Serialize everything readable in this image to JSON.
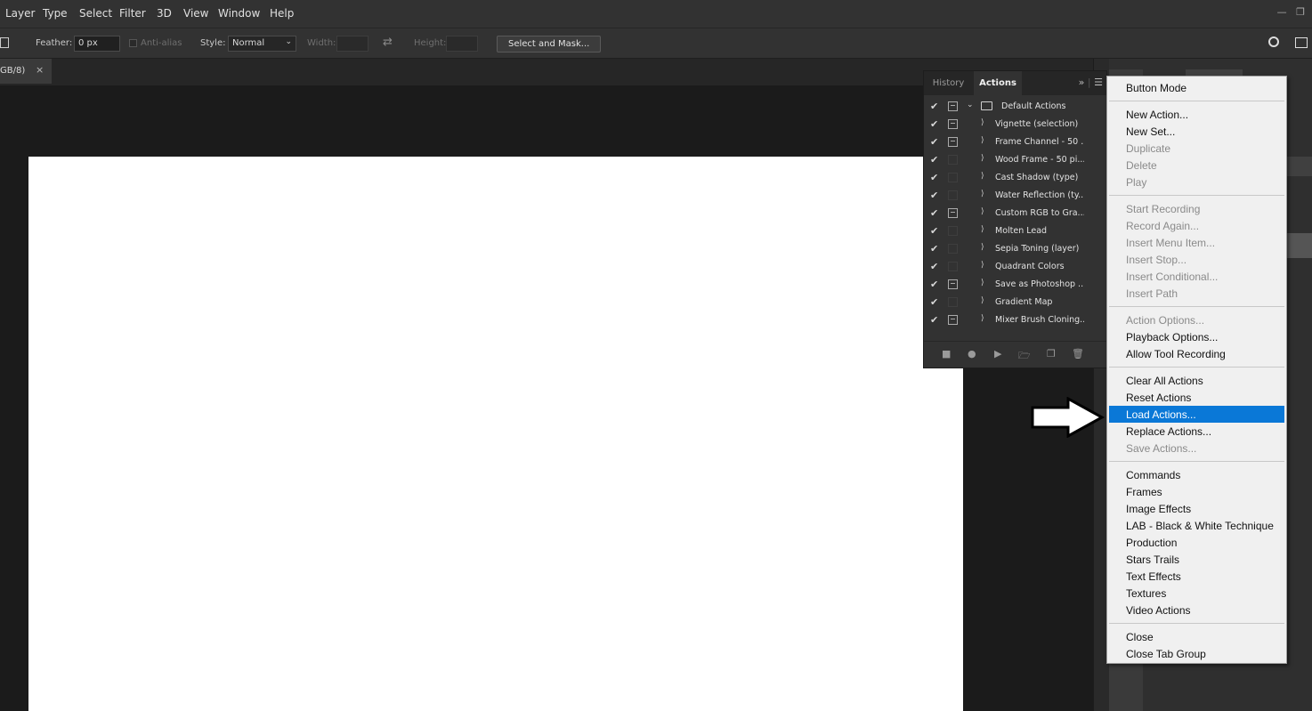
{
  "menubar": {
    "items": [
      "Layer",
      "Type",
      "Select",
      "Filter",
      "3D",
      "View",
      "Window",
      "Help"
    ],
    "window_controls": [
      "minimize",
      "restore"
    ]
  },
  "options": {
    "feather_label": "Feather:",
    "feather_value": "0 px",
    "antialias_label": "Anti-alias",
    "style_label": "Style:",
    "style_value": "Normal",
    "width_label": "Width:",
    "height_label": "Height:",
    "select_mask_label": "Select and Mask..."
  },
  "document_tab": {
    "label": "GB/8)",
    "close": "×"
  },
  "actions_panel": {
    "tabs": [
      "History",
      "Actions"
    ],
    "active_tab": "Actions",
    "set_name": "Default Actions",
    "actions": [
      {
        "name": "Vignette (selection)",
        "dialog": true
      },
      {
        "name": "Frame Channel - 50 ...",
        "dialog": true
      },
      {
        "name": "Wood Frame - 50 pi...",
        "dialog": false
      },
      {
        "name": "Cast Shadow (type)",
        "dialog": false
      },
      {
        "name": "Water Reflection (ty...",
        "dialog": false
      },
      {
        "name": "Custom RGB to Gra...",
        "dialog": true
      },
      {
        "name": "Molten Lead",
        "dialog": false
      },
      {
        "name": "Sepia Toning (layer)",
        "dialog": false
      },
      {
        "name": "Quadrant Colors",
        "dialog": false
      },
      {
        "name": "Save as Photoshop ...",
        "dialog": true
      },
      {
        "name": "Gradient Map",
        "dialog": false
      },
      {
        "name": "Mixer Brush Cloning...",
        "dialog": true
      }
    ]
  },
  "panel_menu": {
    "groups": [
      [
        {
          "label": "Button Mode",
          "state": "enabled"
        }
      ],
      [
        {
          "label": "New Action...",
          "state": "enabled"
        },
        {
          "label": "New Set...",
          "state": "enabled"
        },
        {
          "label": "Duplicate",
          "state": "disabled"
        },
        {
          "label": "Delete",
          "state": "disabled"
        },
        {
          "label": "Play",
          "state": "disabled"
        }
      ],
      [
        {
          "label": "Start Recording",
          "state": "disabled"
        },
        {
          "label": "Record Again...",
          "state": "disabled"
        },
        {
          "label": "Insert Menu Item...",
          "state": "disabled"
        },
        {
          "label": "Insert Stop...",
          "state": "disabled"
        },
        {
          "label": "Insert Conditional...",
          "state": "disabled"
        },
        {
          "label": "Insert Path",
          "state": "disabled"
        }
      ],
      [
        {
          "label": "Action Options...",
          "state": "disabled"
        },
        {
          "label": "Playback Options...",
          "state": "enabled"
        },
        {
          "label": "Allow Tool Recording",
          "state": "enabled"
        }
      ],
      [
        {
          "label": "Clear All Actions",
          "state": "enabled"
        },
        {
          "label": "Reset Actions",
          "state": "enabled"
        },
        {
          "label": "Load Actions...",
          "state": "highlight"
        },
        {
          "label": "Replace Actions...",
          "state": "enabled"
        },
        {
          "label": "Save Actions...",
          "state": "disabled"
        }
      ],
      [
        {
          "label": "Commands",
          "state": "enabled"
        },
        {
          "label": "Frames",
          "state": "enabled"
        },
        {
          "label": "Image Effects",
          "state": "enabled"
        },
        {
          "label": "LAB - Black & White Technique",
          "state": "enabled"
        },
        {
          "label": "Production",
          "state": "enabled"
        },
        {
          "label": "Stars Trails",
          "state": "enabled"
        },
        {
          "label": "Text Effects",
          "state": "enabled"
        },
        {
          "label": "Textures",
          "state": "enabled"
        },
        {
          "label": "Video Actions",
          "state": "enabled"
        }
      ],
      [
        {
          "label": "Close",
          "state": "enabled"
        },
        {
          "label": "Close Tab Group",
          "state": "enabled"
        }
      ]
    ]
  },
  "colors": {
    "highlight": "#0a78d7",
    "app_bg": "#323232",
    "workspace": "#1b1b1b",
    "canvas": "#ffffff"
  }
}
